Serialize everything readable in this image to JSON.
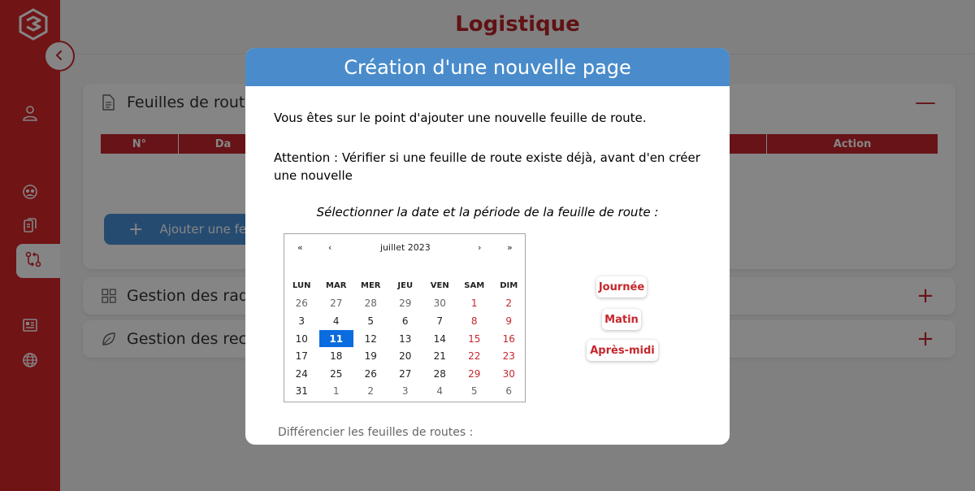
{
  "page": {
    "title": "Logistique"
  },
  "sidebar": {
    "items": [
      {
        "icon": "user-icon"
      },
      {
        "icon": "group-icon"
      },
      {
        "icon": "documents-icon"
      },
      {
        "icon": "route-icon",
        "active": true
      },
      {
        "icon": "newspaper-icon"
      },
      {
        "icon": "globe-icon"
      }
    ],
    "collapse_icon": "chevron-left-icon"
  },
  "sections": [
    {
      "label": "Feuilles de route",
      "icon": "document-icon",
      "toggle": "—"
    },
    {
      "label": "Gestion des rad",
      "icon": "grid-icon",
      "toggle": "+"
    },
    {
      "label": "Gestion des rec",
      "icon": "leaf-icon",
      "toggle": "+"
    }
  ],
  "table": {
    "headers": [
      "N°",
      "Da",
      "",
      "Action"
    ]
  },
  "add_button": {
    "label": "Ajouter une fe",
    "icon": "+"
  },
  "modal": {
    "title": "Création d'une nouvelle page",
    "intro": "Vous êtes sur le point d'ajouter une nouvelle feuille de route.",
    "warning": "Attention : Vérifier si une feuille de route existe déjà, avant d'en créer une nouvelle",
    "select_prompt": "Sélectionner la date et la période de la feuille de route :",
    "footer_label": "Différencier les feuilles de routes :",
    "periods": [
      "Journée",
      "Matin",
      "Après-midi"
    ]
  },
  "calendar": {
    "month_label": "juillet 2023",
    "nav": {
      "prev_year": "«",
      "prev_month": "‹",
      "next_month": "›",
      "next_year": "»"
    },
    "weekdays": [
      "LUN",
      "MAR",
      "MER",
      "JEU",
      "VEN",
      "SAM",
      "DIM"
    ],
    "selected": "11",
    "weeks": [
      [
        "26",
        "27",
        "28",
        "29",
        "30",
        "1",
        "2"
      ],
      [
        "3",
        "4",
        "5",
        "6",
        "7",
        "8",
        "9"
      ],
      [
        "10",
        "11",
        "12",
        "13",
        "14",
        "15",
        "16"
      ],
      [
        "17",
        "18",
        "19",
        "20",
        "21",
        "22",
        "23"
      ],
      [
        "24",
        "25",
        "26",
        "27",
        "28",
        "29",
        "30"
      ],
      [
        "31",
        "1",
        "2",
        "3",
        "4",
        "5",
        "6"
      ]
    ]
  }
}
